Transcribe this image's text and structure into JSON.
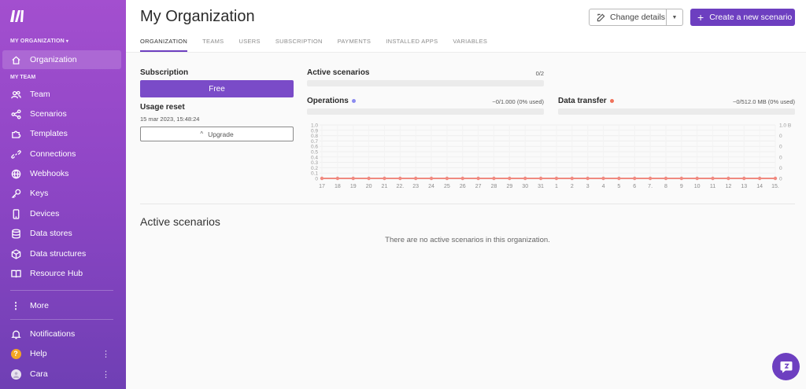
{
  "sidebar": {
    "org_label": "MY ORGANIZATION",
    "org_item": "Organization",
    "team_label": "MY TEAM",
    "items": [
      {
        "label": "Team",
        "icon": "team-icon"
      },
      {
        "label": "Scenarios",
        "icon": "share-nodes-icon"
      },
      {
        "label": "Templates",
        "icon": "puzzle-icon"
      },
      {
        "label": "Connections",
        "icon": "link-icon"
      },
      {
        "label": "Webhooks",
        "icon": "globe-icon"
      },
      {
        "label": "Keys",
        "icon": "key-icon"
      },
      {
        "label": "Devices",
        "icon": "phone-icon"
      },
      {
        "label": "Data stores",
        "icon": "database-icon"
      },
      {
        "label": "Data structures",
        "icon": "cube-icon"
      },
      {
        "label": "Resource Hub",
        "icon": "book-icon"
      }
    ],
    "more": "More",
    "notifications": "Notifications",
    "help": "Help",
    "help_badge": "?",
    "user": "Cara"
  },
  "header": {
    "title": "My Organization",
    "change_details": "Change details",
    "create": "Create a new scenario"
  },
  "tabs": [
    "ORGANIZATION",
    "TEAMS",
    "USERS",
    "SUBSCRIPTION",
    "PAYMENTS",
    "INSTALLED APPS",
    "VARIABLES"
  ],
  "subscription": {
    "label": "Subscription",
    "plan": "Free",
    "usage_reset_label": "Usage reset",
    "usage_reset_date": "15 mar 2023, 15:48:24",
    "upgrade": "Upgrade"
  },
  "stats": {
    "active_scenarios_label": "Active scenarios",
    "active_scenarios_value": "0/2",
    "operations_label": "Operations",
    "operations_value": "~0/1.000 (0% used)",
    "operations_color": "#8b8bf0",
    "data_transfer_label": "Data transfer",
    "data_transfer_value": "~0/512.0 MB (0% used)",
    "data_transfer_color": "#f0725a"
  },
  "chart_data": {
    "type": "line",
    "x": [
      "17",
      "18",
      "19",
      "20",
      "21",
      "22",
      "23",
      "24",
      "25",
      "26",
      "27",
      "28",
      "29",
      "30",
      "31",
      "1",
      "2",
      "3",
      "4",
      "5",
      "6",
      "7",
      "8",
      "9",
      "10",
      "11",
      "12",
      "13",
      "14",
      "15"
    ],
    "x_tick_labels": [
      "17",
      "18",
      "19",
      "20",
      "21",
      "22.",
      "23",
      "24",
      "25",
      "26",
      "27",
      "28",
      "29",
      "30",
      "31",
      "1",
      "2",
      "3",
      "4",
      "5",
      "6",
      "7.",
      "8",
      "9",
      "10",
      "11",
      "12",
      "13",
      "14",
      "15."
    ],
    "y_left_ticks": [
      "1.0",
      "0.9",
      "0.8",
      "0.7",
      "0.6",
      "0.5",
      "0.4",
      "0.3",
      "0.2",
      "0.1",
      "0"
    ],
    "y_right_ticks": [
      "1.0 B",
      "0",
      "0",
      "0",
      "0",
      "0"
    ],
    "ylim": [
      0,
      1
    ],
    "series": [
      {
        "values": [
          0,
          0,
          0,
          0,
          0,
          0,
          0,
          0,
          0,
          0,
          0,
          0,
          0,
          0,
          0,
          0,
          0,
          0,
          0,
          0,
          0,
          0,
          0,
          0,
          0,
          0,
          0,
          0,
          0,
          0
        ],
        "color": "#f08a80"
      }
    ],
    "grid": true
  },
  "active_scenarios": {
    "title": "Active scenarios",
    "empty": "There are no active scenarios in this organization."
  }
}
